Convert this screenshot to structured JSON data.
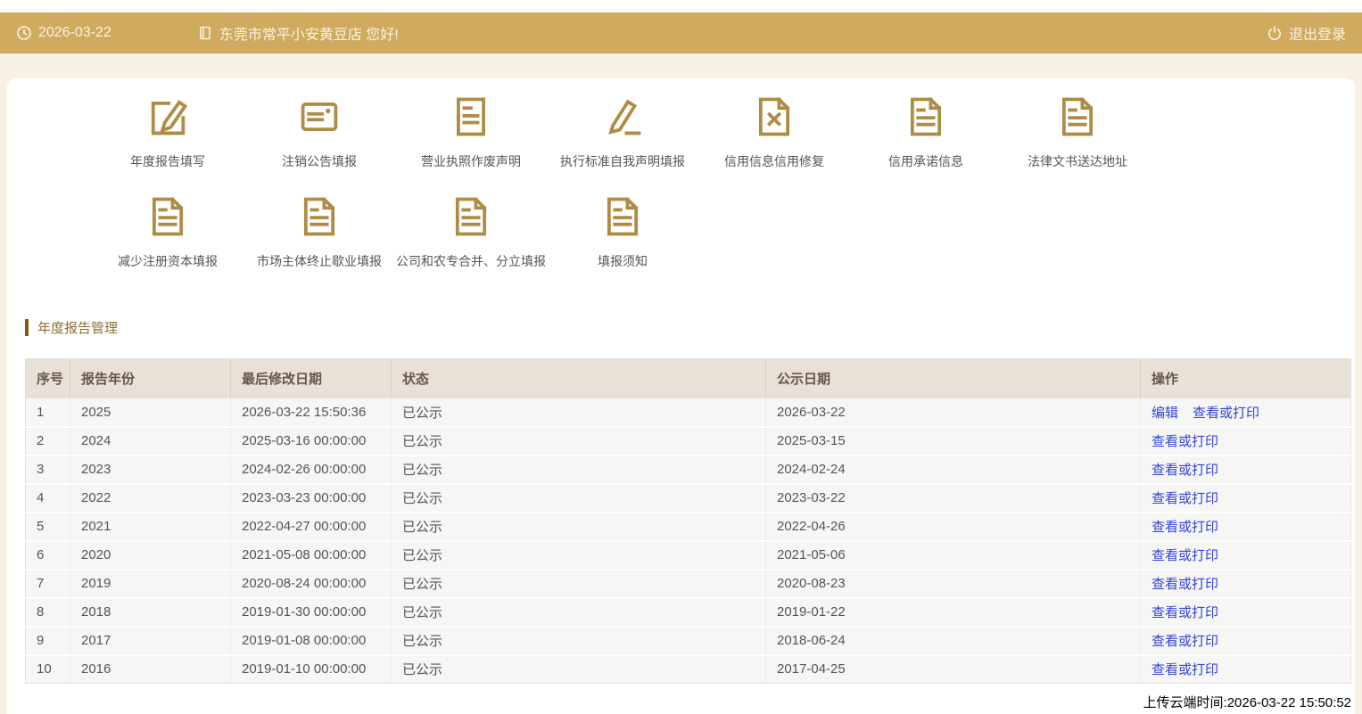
{
  "colors": {
    "accent": "#CFAA5F",
    "icon_gold": "#AE8C45",
    "link_blue": "#3344D6",
    "table_header_bg": "#E9E1D8"
  },
  "topbar": {
    "date": "2026-03-22",
    "company_greeting": "东莞市常平小安黄豆店 您好!",
    "logout_label": "退出登录",
    "icons": [
      "clock-icon",
      "booklet-icon",
      "power-icon"
    ]
  },
  "menu_items": [
    {
      "label": "年度报告填写",
      "icon": "edit-square-icon"
    },
    {
      "label": "注销公告填报",
      "icon": "announcement-card-icon"
    },
    {
      "label": "营业执照作废声明",
      "icon": "document-lines-icon"
    },
    {
      "label": "执行标准自我声明填报",
      "icon": "pencil-icon"
    },
    {
      "label": "信用信息信用修复",
      "icon": "document-x-icon"
    },
    {
      "label": "信用承诺信息",
      "icon": "document-folded-icon"
    },
    {
      "label": "法律文书送达地址",
      "icon": "document-folded-icon"
    },
    {
      "label": "减少注册资本填报",
      "icon": "document-folded-icon"
    },
    {
      "label": "市场主体终止歇业填报",
      "icon": "document-folded-icon"
    },
    {
      "label": "公司和农专合并、分立填报",
      "icon": "document-folded-icon"
    },
    {
      "label": "填报须知",
      "icon": "document-folded-icon"
    }
  ],
  "section": {
    "title": "年度报告管理"
  },
  "table": {
    "headers": [
      "序号",
      "报告年份",
      "最后修改日期",
      "状态",
      "公示日期",
      "操作"
    ],
    "rows": [
      {
        "no": "1",
        "year": "2025",
        "modified": "2026-03-22 15:50:36",
        "status": "已公示",
        "published": "2026-03-22",
        "actions": [
          "编辑",
          "查看或打印"
        ]
      },
      {
        "no": "2",
        "year": "2024",
        "modified": "2025-03-16 00:00:00",
        "status": "已公示",
        "published": "2025-03-15",
        "actions": [
          "查看或打印"
        ]
      },
      {
        "no": "3",
        "year": "2023",
        "modified": "2024-02-26 00:00:00",
        "status": "已公示",
        "published": "2024-02-24",
        "actions": [
          "查看或打印"
        ]
      },
      {
        "no": "4",
        "year": "2022",
        "modified": "2023-03-23 00:00:00",
        "status": "已公示",
        "published": "2023-03-22",
        "actions": [
          "查看或打印"
        ]
      },
      {
        "no": "5",
        "year": "2021",
        "modified": "2022-04-27 00:00:00",
        "status": "已公示",
        "published": "2022-04-26",
        "actions": [
          "查看或打印"
        ]
      },
      {
        "no": "6",
        "year": "2020",
        "modified": "2021-05-08 00:00:00",
        "status": "已公示",
        "published": "2021-05-06",
        "actions": [
          "查看或打印"
        ]
      },
      {
        "no": "7",
        "year": "2019",
        "modified": "2020-08-24 00:00:00",
        "status": "已公示",
        "published": "2020-08-23",
        "actions": [
          "查看或打印"
        ]
      },
      {
        "no": "8",
        "year": "2018",
        "modified": "2019-01-30 00:00:00",
        "status": "已公示",
        "published": "2019-01-22",
        "actions": [
          "查看或打印"
        ]
      },
      {
        "no": "9",
        "year": "2017",
        "modified": "2019-01-08 00:00:00",
        "status": "已公示",
        "published": "2018-06-24",
        "actions": [
          "查看或打印"
        ]
      },
      {
        "no": "10",
        "year": "2016",
        "modified": "2019-01-10 00:00:00",
        "status": "已公示",
        "published": "2017-04-25",
        "actions": [
          "查看或打印"
        ]
      }
    ]
  },
  "footer": {
    "upload_time": "上传云端时间:2026-03-22 15:50:52"
  }
}
